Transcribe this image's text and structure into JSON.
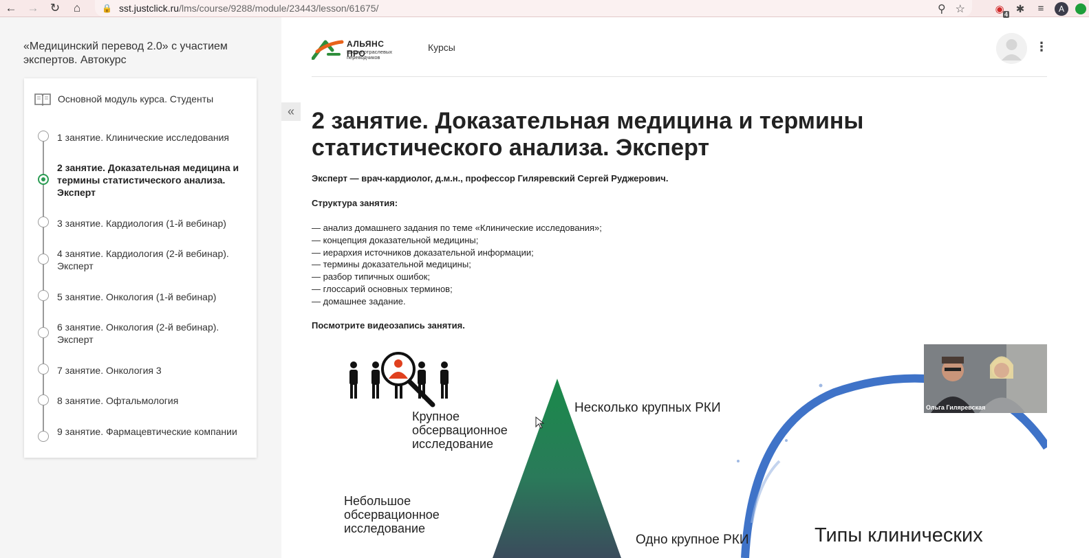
{
  "browser": {
    "url_host": "sst.justclick.ru",
    "url_path": "/lms/course/9288/module/23443/lesson/61675/",
    "extension_badge": "4",
    "profile_initial": "A"
  },
  "sidebar": {
    "course_title": "«Медицинский перевод 2.0» с участием экспертов. Автокурс",
    "module_label": "Основной модуль курса. Студенты",
    "lessons": [
      {
        "label": "1 занятие. Клинические исследования"
      },
      {
        "label": "2 занятие. Доказательная медицина и термины статистического анализа. Эксперт"
      },
      {
        "label": "3 занятие. Кардиология (1-й вебинар)"
      },
      {
        "label": "4 занятие. Кардиология (2-й вебинар). Эксперт"
      },
      {
        "label": "5 занятие. Онкология (1-й вебинар)"
      },
      {
        "label": "6 занятие. Онкология (2-й вебинар). Эксперт"
      },
      {
        "label": "7 занятие. Онкология 3"
      },
      {
        "label": "8 занятие. Офтальмология"
      },
      {
        "label": "9 занятие. Фармацевтические компании"
      }
    ],
    "active_index": 1
  },
  "header": {
    "logo_name": "АЛЬЯНС ПРО",
    "logo_tagline": "Школа отраслевых переводчиков",
    "nav_courses": "Курсы"
  },
  "content": {
    "title": "2 занятие. Доказательная медицина и термины статистического анализа. Эксперт",
    "expert": "Эксперт — врач-кардиолог, д.м.н., профессор Гиляревский Сергей Руджерович.",
    "structure_heading": "Структура занятия:",
    "structure_items": [
      "— анализ домашнего задания по теме «Клинические исследования»;",
      "— концепция доказательной медицины;",
      "— иерархия источников доказательной информации;",
      "— термины доказательной медицины;",
      "— разбор типичных ошибок;",
      "— глоссарий основных терминов;",
      "— домашнее задание."
    ],
    "watch_prompt": "Посмотрите видеозапись занятия."
  },
  "video": {
    "slide_top_label": "Несколько крупных РКИ",
    "slide_large_obs": "Крупное обсервационное исследование",
    "slide_small_obs": "Небольшое обсервационное исследование",
    "slide_one_rct": "Одно крупное РКИ",
    "slide_types": "Типы клинических",
    "speaker_label": "Ольга Гиляревская"
  },
  "colors": {
    "accent_green": "#2a9b52",
    "logo_orange": "#e8621a",
    "logo_green": "#2f8f3c",
    "pyramid_green": "#1a8a4a",
    "pyramid_dark": "#3b4b5c",
    "circle_blue": "#3f73c8",
    "person_red": "#e0401e"
  }
}
